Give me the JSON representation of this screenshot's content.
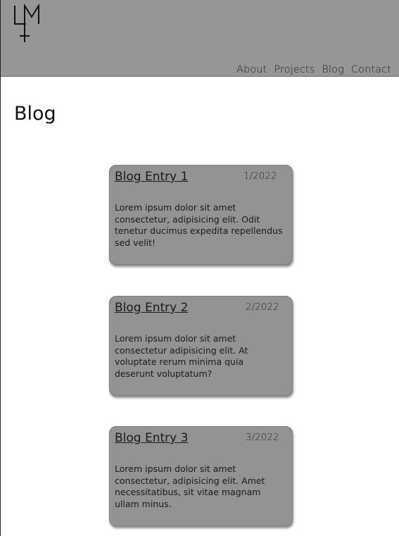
{
  "header": {
    "logo_text": "LM",
    "nav": [
      {
        "label": "About"
      },
      {
        "label": "Projects"
      },
      {
        "label": "Blog"
      },
      {
        "label": "Contact"
      }
    ]
  },
  "main": {
    "title": "Blog",
    "entries": [
      {
        "title": "Blog Entry 1",
        "date": "1/2022",
        "body": "Lorem ipsum dolor sit amet consectetur, adipisicing elit. Odit tenetur ducimus expedita repellendus sed velit!"
      },
      {
        "title": "Blog Entry 2",
        "date": "2/2022",
        "body": "Lorem ipsum dolor sit amet consectetur adipisicing elit. At voluptate rerum minima quia deserunt voluptatum?"
      },
      {
        "title": "Blog Entry 3",
        "date": "3/2022",
        "body": "Lorem ipsum dolor sit amet consectetur, adipisicing elit. Amet necessitatibus, sit vitae magnam ullam minus."
      }
    ]
  },
  "colors": {
    "header_bg": "#969696",
    "card_bg": "#939393",
    "text": "#111111"
  }
}
